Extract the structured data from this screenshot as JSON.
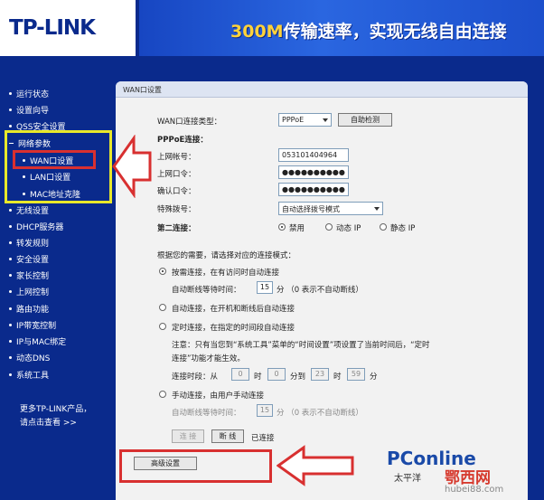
{
  "header": {
    "logo": "TP-LINK",
    "slogan_num": "300M",
    "slogan_text": "传输速率，实现无线自由连接"
  },
  "sidebar": {
    "items": [
      {
        "label": "运行状态"
      },
      {
        "label": "设置向导"
      },
      {
        "label": "QSS安全设置"
      },
      {
        "label": "网络参数"
      },
      {
        "label": "WAN口设置"
      },
      {
        "label": "LAN口设置"
      },
      {
        "label": "MAC地址克隆"
      },
      {
        "label": "无线设置"
      },
      {
        "label": "DHCP服务器"
      },
      {
        "label": "转发规则"
      },
      {
        "label": "安全设置"
      },
      {
        "label": "家长控制"
      },
      {
        "label": "上网控制"
      },
      {
        "label": "路由功能"
      },
      {
        "label": "IP带宽控制"
      },
      {
        "label": "IP与MAC绑定"
      },
      {
        "label": "动态DNS"
      },
      {
        "label": "系统工具"
      }
    ],
    "more_line1": "更多TP-LINK产品，",
    "more_line2": "请点击查看 >>"
  },
  "panel": {
    "title": "WAN口设置",
    "wan_type_label": "WAN口连接类型：",
    "wan_type_value": "PPPoE",
    "auto_detect_btn": "自助检测",
    "pppoe_heading": "PPPoE连接：",
    "account_label": "上网帐号：",
    "account_value": "053101404964",
    "password_label": "上网口令：",
    "password_value": "●●●●●●●●●●",
    "confirm_label": "确认口令：",
    "confirm_value": "●●●●●●●●●●",
    "dial_label": "特殊拨号：",
    "dial_value": "自动选择拨号模式",
    "second_label": "第二连接：",
    "second_opts": [
      "禁用",
      "动态 IP",
      "静态 IP"
    ],
    "mode_hint": "根据您的需要，请选择对应的连接模式：",
    "mode1": "按需连接，在有访问时自动连接",
    "idle_label": "自动断线等待时间：",
    "idle_value": "15",
    "idle_unit": "分 （0 表示不自动断线）",
    "mode2": "自动连接，在开机和断线后自动连接",
    "mode3": "定时连接，在指定的时间段自动连接",
    "note1": "注意：只有当您到“系统工具”菜单的“时间设置”项设置了当前时间后，“定时",
    "note2": "连接”功能才能生效。",
    "period_label": "连接时段：从",
    "period_h1": "0",
    "period_hour": "时",
    "period_m1": "0",
    "period_to": "分到",
    "period_h2": "23",
    "period_hour2": "时",
    "period_m2": "59",
    "period_min2": "分",
    "mode4": "手动连接，由用户手动连接",
    "idle2_label": "自动断线等待时间：",
    "idle2_value": "15",
    "idle2_unit": "分 （0 表示不自动断线）",
    "connect_btn": "连 接",
    "disconnect_btn": "断 线",
    "status_text": "已连接",
    "advanced_btn": "高级设置"
  },
  "watermark": {
    "pc": "PConline",
    "sub": "太平洋",
    "cn": "鄂西网",
    "url": "hubei88.com"
  },
  "colors": {
    "brand_blue": "#0a2a8c",
    "highlight_yellow": "#e8e82a",
    "highlight_red": "#d83030"
  }
}
